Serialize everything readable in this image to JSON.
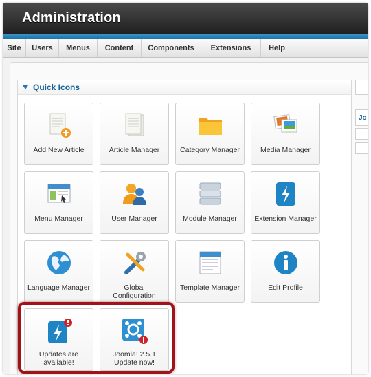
{
  "header": {
    "title": "Administration"
  },
  "menu": [
    "Site",
    "Users",
    "Menus",
    "Content",
    "Components",
    "Extensions",
    "Help"
  ],
  "panel": {
    "title": "Quick Icons"
  },
  "tiles": [
    {
      "label": "Add New Article",
      "icon": "add-article-icon"
    },
    {
      "label": "Article Manager",
      "icon": "article-manager-icon"
    },
    {
      "label": "Category Manager",
      "icon": "folder-icon"
    },
    {
      "label": "Media Manager",
      "icon": "media-icon"
    },
    {
      "label": "Menu Manager",
      "icon": "menu-manager-icon"
    },
    {
      "label": "User Manager",
      "icon": "users-icon"
    },
    {
      "label": "Module Manager",
      "icon": "module-icon"
    },
    {
      "label": "Extension Manager",
      "icon": "extension-icon"
    },
    {
      "label": "Language Manager",
      "icon": "globe-icon"
    },
    {
      "label": "Global Configuration",
      "icon": "tools-icon"
    },
    {
      "label": "Template Manager",
      "icon": "template-icon"
    },
    {
      "label": "Edit Profile",
      "icon": "info-icon"
    },
    {
      "label": "Updates are available!",
      "icon": "extension-update-icon"
    },
    {
      "label": "Joomla! 2.5.1 Update now!",
      "icon": "joomla-update-icon"
    }
  ],
  "right_strip": {
    "fragment": "Jo"
  }
}
